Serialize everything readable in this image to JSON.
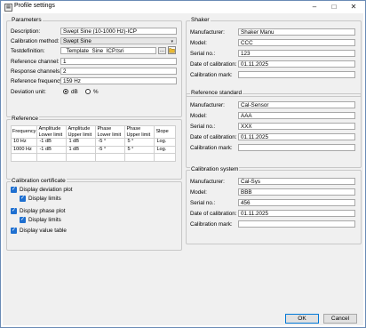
{
  "window": {
    "title": "Profile settings"
  },
  "parameters": {
    "group_title": "Parameters",
    "description_label": "Description:",
    "description_value": "Swept Sine (10-1000 Hz)-ICP",
    "calibration_method_label": "Calibration method:",
    "calibration_method_value": "Swept Sine",
    "testdefinition_label": "Testdefinition:",
    "testdefinition_value": "_Template_Sine_ICP.tsri",
    "browse_label": "...",
    "reference_channel_label": "Reference channel:",
    "reference_channel_value": "1",
    "response_channels_label": "Response channels:",
    "response_channels_value": "2",
    "reference_frequency_label": "Reference frequency:",
    "reference_frequency_value": "159 Hz",
    "deviation_unit_label": "Deviation unit:",
    "deviation_options": [
      {
        "label": "dB",
        "selected": true
      },
      {
        "label": "%",
        "selected": false
      }
    ]
  },
  "reference": {
    "group_title": "Reference",
    "columns": [
      "Frequency",
      "Amplitude Lower limit",
      "Amplitude Upper limit",
      "Phase Lower limit",
      "Phase Upper limit",
      "Slope"
    ],
    "rows": [
      [
        "10 Hz",
        "-1 dB",
        "1 dB",
        "-5 °",
        "5 °",
        "Log."
      ],
      [
        "1000 Hz",
        "-1 dB",
        "1 dB",
        "-5 °",
        "5 °",
        "Log."
      ]
    ]
  },
  "calibration_certificate": {
    "group_title": "Calibration certificate",
    "display_deviation_plot": "Display deviation plot",
    "display_limits_1": "Display limits",
    "display_phase_plot": "Display phase plot",
    "display_limits_2": "Display limits",
    "display_value_table": "Display value table"
  },
  "shaker": {
    "group_title": "Shaker",
    "manufacturer_label": "Manufacturer:",
    "manufacturer_value": "Shaker Manu",
    "model_label": "Model:",
    "model_value": "CCC",
    "serial_label": "Serial no.:",
    "serial_value": "123",
    "date_label": "Date of calibration:",
    "date_value": "01.11.2025",
    "mark_label": "Calibration mark:",
    "mark_value": ""
  },
  "reference_standard": {
    "group_title": "Reference standard",
    "manufacturer_label": "Manufacturer:",
    "manufacturer_value": "Cal-Sensor",
    "model_label": "Model:",
    "model_value": "AAA",
    "serial_label": "Serial no.:",
    "serial_value": "XXX",
    "date_label": "Date of calibration:",
    "date_value": "01.11.2025",
    "mark_label": "Calibration mark:",
    "mark_value": ""
  },
  "calibration_system": {
    "group_title": "Calibration system",
    "manufacturer_label": "Manufacturer:",
    "manufacturer_value": "Cal-Sys",
    "model_label": "Model:",
    "model_value": "BBB",
    "serial_label": "Serial no.:",
    "serial_value": "456",
    "date_label": "Date of calibration:",
    "date_value": "01.11.2025",
    "mark_label": "Calibration mark:",
    "mark_value": ""
  },
  "buttons": {
    "ok": "OK",
    "cancel": "Cancel"
  },
  "colors": {
    "accent": "#1e6fd0",
    "folder": "#e8b830"
  }
}
